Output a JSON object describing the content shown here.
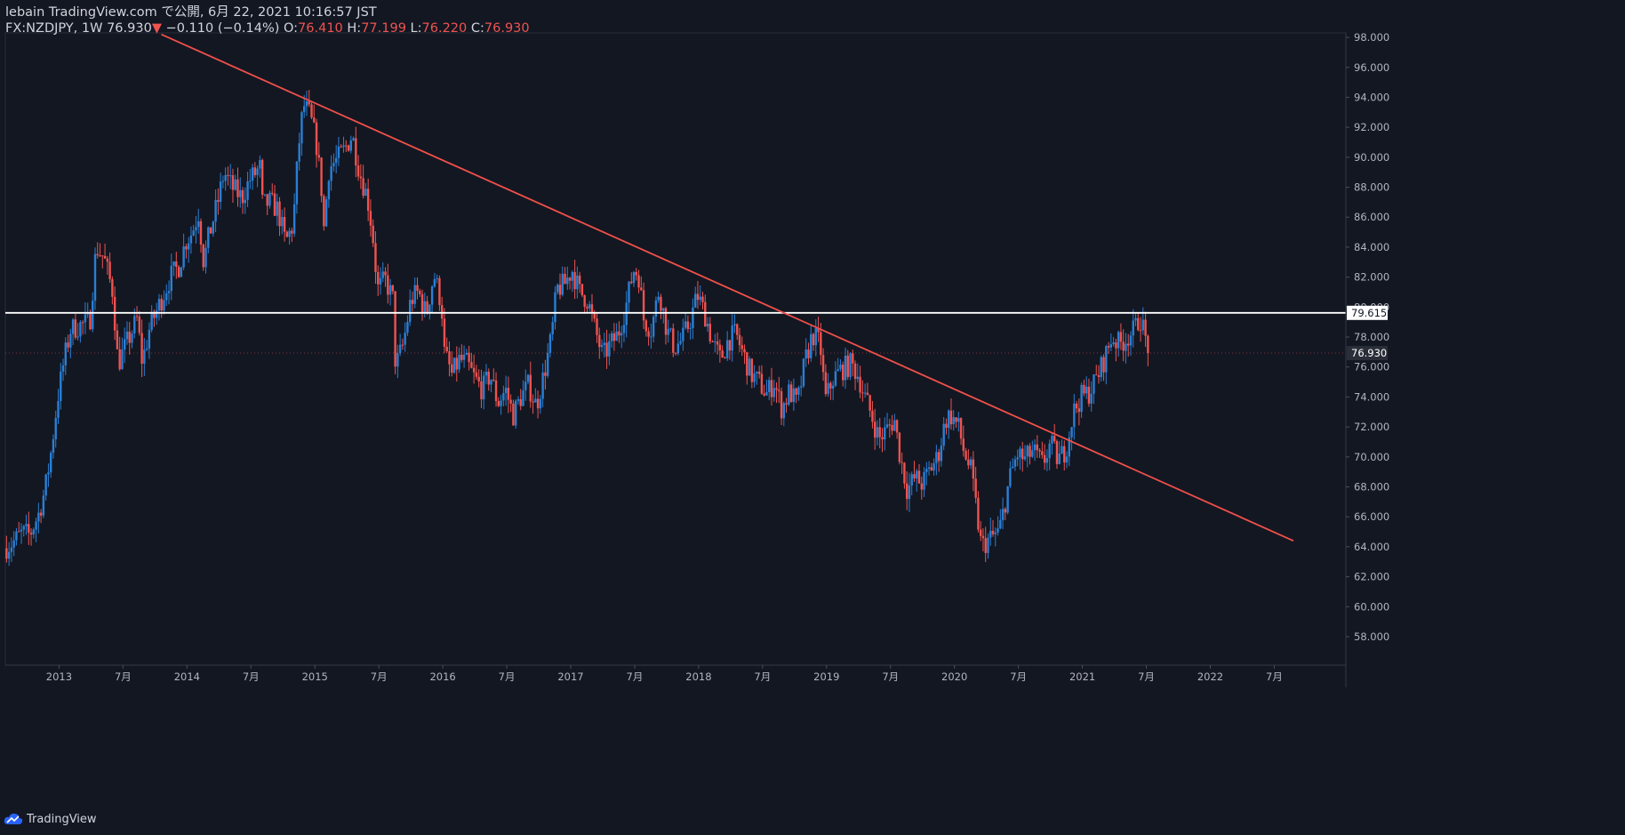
{
  "header": {
    "publisher_line": "lebain TradingView.com で公開, 6月 22, 2021 10:16:57 JST",
    "symbol": "FX:NZDJPY, 1W",
    "last": "76.930",
    "change_arrow": "▼",
    "change": "−0.110 (−0.14%)",
    "o_label": "O:",
    "o_value": "76.410",
    "h_label": "H:",
    "h_value": "77.199",
    "l_label": "L:",
    "l_value": "76.220",
    "c_label": "C:",
    "c_value": "76.930"
  },
  "footer": {
    "brand": "TradingView"
  },
  "colors": {
    "background": "#131722",
    "up": "#2a7fd4",
    "down": "#ef5350",
    "trendline": "#f0504a",
    "horizontal_line": "#ffffff",
    "axis_text": "#b2b5be",
    "price_tag_bg": "#2a2e39"
  },
  "chart_data": {
    "type": "candlestick",
    "symbol": "FX:NZDJPY",
    "interval": "1W",
    "y_ticks": [
      "98.000",
      "96.000",
      "94.000",
      "92.000",
      "90.000",
      "88.000",
      "86.000",
      "84.000",
      "82.000",
      "80.000",
      "78.000",
      "76.000",
      "74.000",
      "72.000",
      "70.000",
      "68.000",
      "66.000",
      "64.000",
      "62.000",
      "60.000",
      "58.000"
    ],
    "x_ticks": [
      {
        "label": "2013",
        "date": 2013.0
      },
      {
        "label": "7月",
        "date": 2013.5
      },
      {
        "label": "2014",
        "date": 2014.0
      },
      {
        "label": "7月",
        "date": 2014.5
      },
      {
        "label": "2015",
        "date": 2015.0
      },
      {
        "label": "7月",
        "date": 2015.5
      },
      {
        "label": "2016",
        "date": 2016.0
      },
      {
        "label": "7月",
        "date": 2016.5
      },
      {
        "label": "2017",
        "date": 2017.0
      },
      {
        "label": "7月",
        "date": 2017.5
      },
      {
        "label": "2018",
        "date": 2018.0
      },
      {
        "label": "7月",
        "date": 2018.5
      },
      {
        "label": "2019",
        "date": 2019.0
      },
      {
        "label": "7月",
        "date": 2019.5
      },
      {
        "label": "2020",
        "date": 2020.0
      },
      {
        "label": "7月",
        "date": 2020.5
      },
      {
        "label": "2021",
        "date": 2021.0
      },
      {
        "label": "7月",
        "date": 2021.5
      },
      {
        "label": "2022",
        "date": 2022.0
      },
      {
        "label": "7月",
        "date": 2022.5
      }
    ],
    "y_range": [
      56.1,
      98.3
    ],
    "date_range": [
      2012.58,
      2023.06
    ],
    "horizontal_line": {
      "price": 79.615,
      "label": "79.615"
    },
    "last_price": {
      "price": 76.93,
      "label": "76.930"
    },
    "trendline": {
      "start": {
        "date": 2013.8,
        "price": 98.2
      },
      "end": {
        "date": 2022.65,
        "price": 64.4
      }
    },
    "price_path": [
      [
        2012.58,
        63.9
      ],
      [
        2012.65,
        64.3
      ],
      [
        2012.72,
        64.9
      ],
      [
        2012.78,
        64.8
      ],
      [
        2012.85,
        66.2
      ],
      [
        2012.9,
        67.8
      ],
      [
        2012.95,
        70.5
      ],
      [
        2013.0,
        74.0
      ],
      [
        2013.05,
        76.5
      ],
      [
        2013.1,
        78.5
      ],
      [
        2013.18,
        78.8
      ],
      [
        2013.25,
        79.0
      ],
      [
        2013.3,
        84.0
      ],
      [
        2013.36,
        83.3
      ],
      [
        2013.43,
        81.0
      ],
      [
        2013.47,
        76.2
      ],
      [
        2013.55,
        77.8
      ],
      [
        2013.62,
        79.2
      ],
      [
        2013.66,
        76.3
      ],
      [
        2013.72,
        78.7
      ],
      [
        2013.8,
        80.3
      ],
      [
        2013.88,
        82.0
      ],
      [
        2013.95,
        82.8
      ],
      [
        2014.0,
        84.4
      ],
      [
        2014.05,
        85.0
      ],
      [
        2014.1,
        86.3
      ],
      [
        2014.14,
        83.0
      ],
      [
        2014.18,
        84.7
      ],
      [
        2014.25,
        87.0
      ],
      [
        2014.3,
        89.0
      ],
      [
        2014.36,
        88.0
      ],
      [
        2014.44,
        87.3
      ],
      [
        2014.5,
        88.5
      ],
      [
        2014.58,
        89.3
      ],
      [
        2014.6,
        86.8
      ],
      [
        2014.66,
        87.0
      ],
      [
        2014.72,
        86.5
      ],
      [
        2014.78,
        84.3
      ],
      [
        2014.84,
        85.5
      ],
      [
        2014.88,
        90.5
      ],
      [
        2014.92,
        93.5
      ],
      [
        2014.97,
        92.8
      ],
      [
        2015.02,
        91.0
      ],
      [
        2015.06,
        88.0
      ],
      [
        2015.08,
        85.3
      ],
      [
        2015.12,
        89.3
      ],
      [
        2015.18,
        89.8
      ],
      [
        2015.24,
        90.5
      ],
      [
        2015.3,
        91.5
      ],
      [
        2015.36,
        89.0
      ],
      [
        2015.42,
        87.3
      ],
      [
        2015.46,
        85.0
      ],
      [
        2015.5,
        81.2
      ],
      [
        2015.56,
        81.8
      ],
      [
        2015.62,
        80.5
      ],
      [
        2015.64,
        76.0
      ],
      [
        2015.7,
        77.5
      ],
      [
        2015.76,
        80.5
      ],
      [
        2015.82,
        81.0
      ],
      [
        2015.88,
        79.5
      ],
      [
        2015.94,
        82.2
      ],
      [
        2016.0,
        80.2
      ],
      [
        2016.02,
        77.0
      ],
      [
        2016.08,
        75.5
      ],
      [
        2016.14,
        76.5
      ],
      [
        2016.2,
        76.2
      ],
      [
        2016.26,
        75.2
      ],
      [
        2016.32,
        74.5
      ],
      [
        2016.38,
        75.5
      ],
      [
        2016.44,
        73.6
      ],
      [
        2016.5,
        74.5
      ],
      [
        2016.56,
        72.8
      ],
      [
        2016.62,
        74.0
      ],
      [
        2016.68,
        74.8
      ],
      [
        2016.74,
        73.4
      ],
      [
        2016.8,
        75.5
      ],
      [
        2016.86,
        78.0
      ],
      [
        2016.9,
        81.2
      ],
      [
        2016.96,
        81.5
      ],
      [
        2017.02,
        82.5
      ],
      [
        2017.08,
        81.0
      ],
      [
        2017.14,
        80.5
      ],
      [
        2017.2,
        78.5
      ],
      [
        2017.26,
        76.7
      ],
      [
        2017.32,
        77.5
      ],
      [
        2017.38,
        78.2
      ],
      [
        2017.44,
        80.0
      ],
      [
        2017.5,
        82.5
      ],
      [
        2017.54,
        82.2
      ],
      [
        2017.58,
        79.2
      ],
      [
        2017.64,
        78.5
      ],
      [
        2017.7,
        81.2
      ],
      [
        2017.76,
        78.5
      ],
      [
        2017.82,
        77.3
      ],
      [
        2017.88,
        77.8
      ],
      [
        2017.94,
        79.0
      ],
      [
        2018.0,
        80.8
      ],
      [
        2018.06,
        79.5
      ],
      [
        2018.12,
        77.6
      ],
      [
        2018.18,
        76.5
      ],
      [
        2018.24,
        77.8
      ],
      [
        2018.3,
        78.2
      ],
      [
        2018.36,
        76.8
      ],
      [
        2018.42,
        75.5
      ],
      [
        2018.48,
        75.0
      ],
      [
        2018.54,
        74.2
      ],
      [
        2018.6,
        75.0
      ],
      [
        2018.66,
        73.2
      ],
      [
        2018.72,
        74.4
      ],
      [
        2018.78,
        73.5
      ],
      [
        2018.84,
        76.3
      ],
      [
        2018.9,
        78.2
      ],
      [
        2018.96,
        77.5
      ],
      [
        2019.0,
        73.8
      ],
      [
        2019.06,
        75.2
      ],
      [
        2019.12,
        75.8
      ],
      [
        2019.2,
        76.2
      ],
      [
        2019.26,
        75.4
      ],
      [
        2019.3,
        74.2
      ],
      [
        2019.36,
        72.8
      ],
      [
        2019.42,
        71.2
      ],
      [
        2019.48,
        71.8
      ],
      [
        2019.54,
        72.5
      ],
      [
        2019.58,
        70.3
      ],
      [
        2019.64,
        67.8
      ],
      [
        2019.7,
        68.6
      ],
      [
        2019.76,
        68.2
      ],
      [
        2019.82,
        69.2
      ],
      [
        2019.88,
        70.0
      ],
      [
        2019.94,
        72.5
      ],
      [
        2019.98,
        72.8
      ],
      [
        2020.04,
        72.0
      ],
      [
        2020.08,
        70.5
      ],
      [
        2020.14,
        69.0
      ],
      [
        2020.18,
        66.5
      ],
      [
        2020.22,
        64.0
      ],
      [
        2020.28,
        64.5
      ],
      [
        2020.36,
        65.0
      ],
      [
        2020.44,
        68.5
      ],
      [
        2020.5,
        70.2
      ],
      [
        2020.56,
        69.8
      ],
      [
        2020.62,
        70.4
      ],
      [
        2020.7,
        69.5
      ],
      [
        2020.76,
        70.9
      ],
      [
        2020.82,
        69.8
      ],
      [
        2020.88,
        70.5
      ],
      [
        2020.94,
        73.0
      ],
      [
        2021.0,
        74.0
      ],
      [
        2021.06,
        74.3
      ],
      [
        2021.12,
        75.2
      ],
      [
        2021.18,
        76.5
      ],
      [
        2021.24,
        78.0
      ],
      [
        2021.3,
        77.5
      ],
      [
        2021.36,
        78.0
      ],
      [
        2021.42,
        78.5
      ],
      [
        2021.46,
        79.4
      ],
      [
        2021.5,
        78.0
      ],
      [
        2021.52,
        76.93
      ]
    ]
  }
}
